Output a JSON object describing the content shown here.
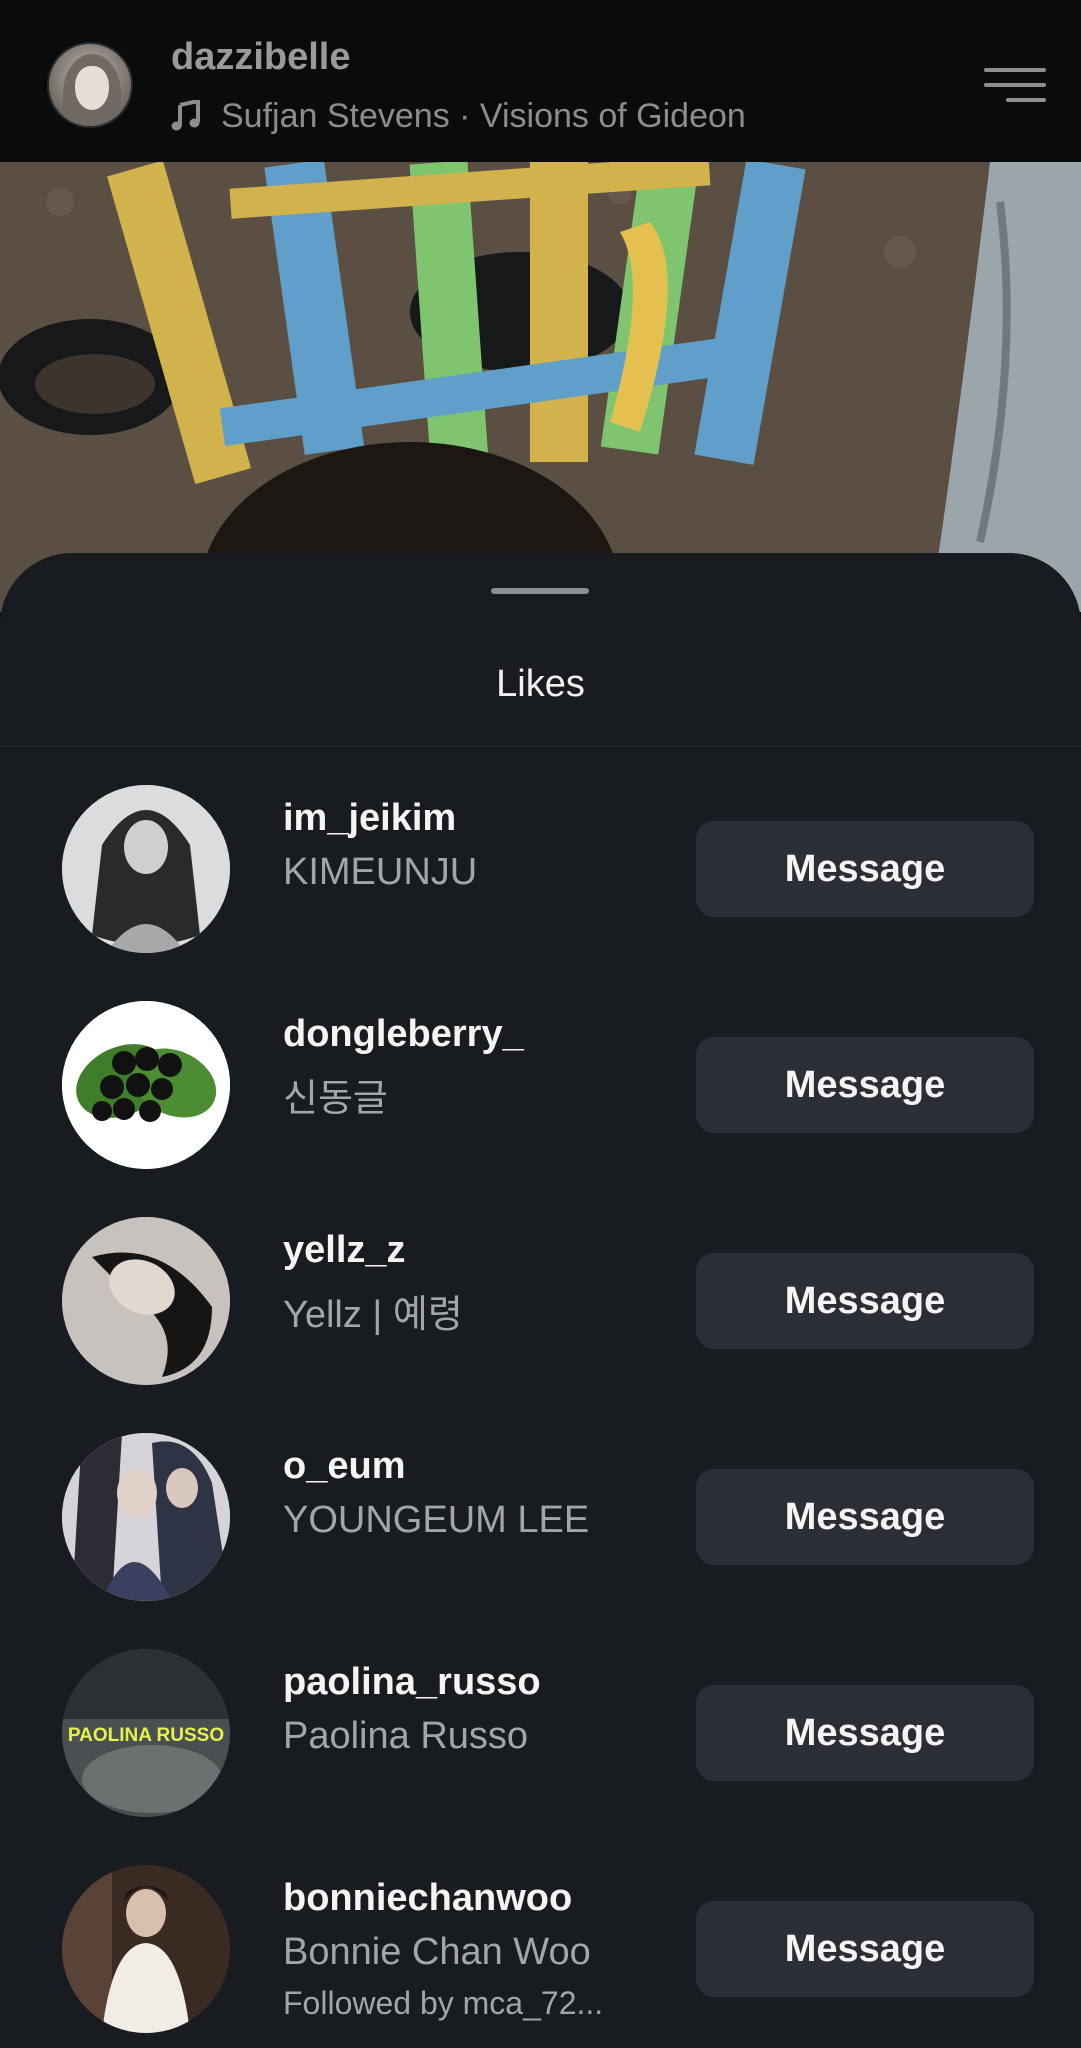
{
  "header": {
    "username": "dazzibelle",
    "music": "Sufjan Stevens · Visions of Gideon"
  },
  "sheet": {
    "title": "Likes"
  },
  "likes": [
    {
      "username": "im_jeikim",
      "full_name": "KIMEUNJU",
      "button": "Message"
    },
    {
      "username": "dongleberry_",
      "full_name": "신동글",
      "button": "Message"
    },
    {
      "username": "yellz_z",
      "full_name": "Yellz | 예령",
      "button": "Message"
    },
    {
      "username": "o_eum",
      "full_name": "YOUNGEUM LEE",
      "button": "Message"
    },
    {
      "username": "paolina_russo",
      "full_name": "Paolina Russo",
      "avatar_text": "PAOLINA RUSSO",
      "button": "Message"
    },
    {
      "username": "bonniechanwoo",
      "full_name": "Bonnie Chan Woo",
      "subtitle": "Followed by mca_72...",
      "button": "Message"
    }
  ],
  "colors": {
    "background": "#181b1f",
    "button": "#2b2f35",
    "text_primary": "#f4f4f4",
    "text_secondary": "#a2a5a9"
  }
}
